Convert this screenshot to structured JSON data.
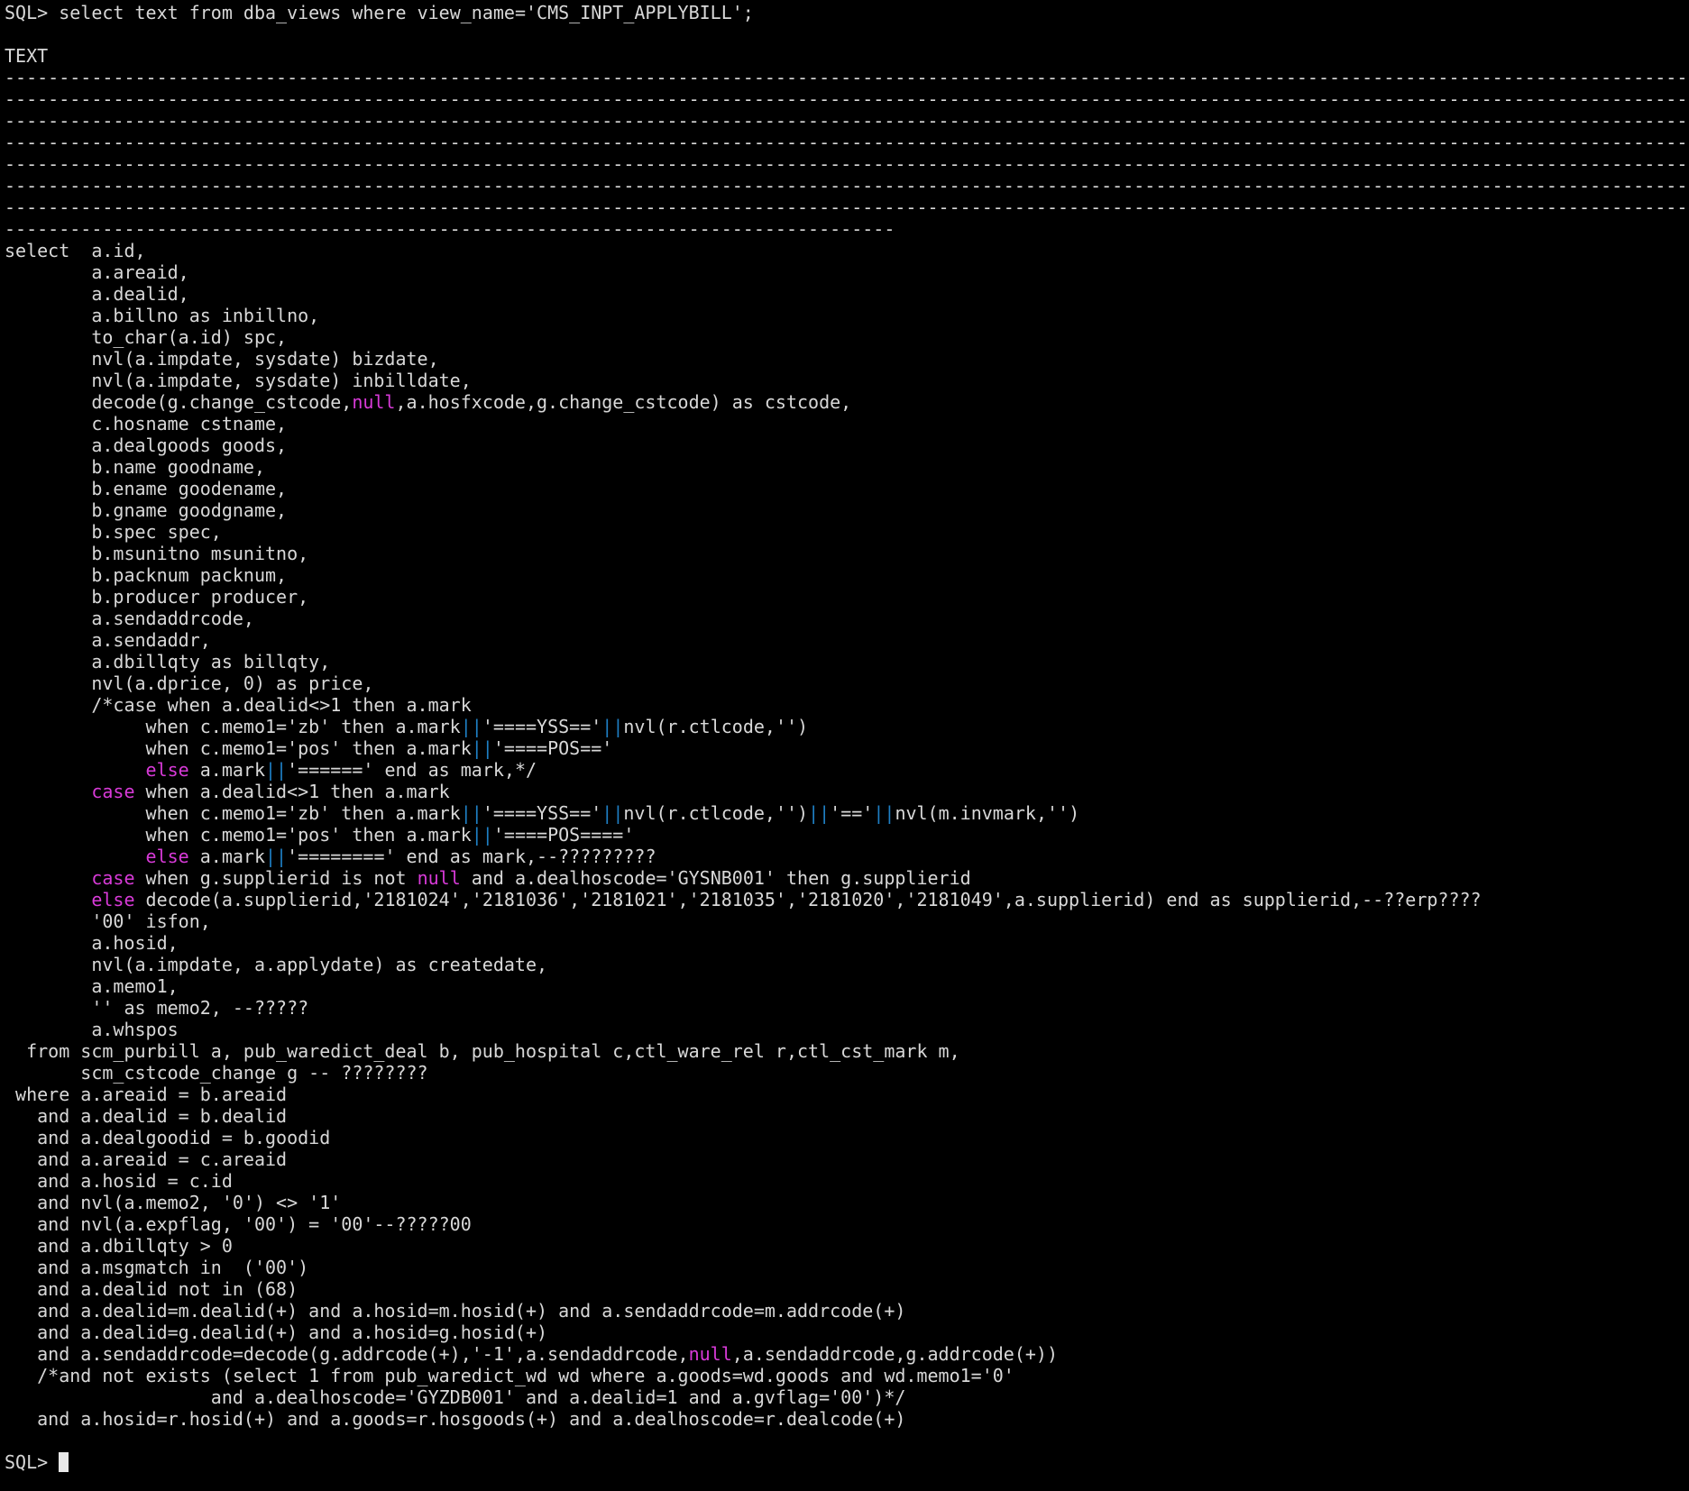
{
  "terminal": {
    "prompt": "SQL> ",
    "command": "select text from dba_views where view_name='CMS_INPT_APPLYBILL';",
    "column_header": "TEXT",
    "separator_full": "----------------------------------------------------------------------------------------------------------------------------------------------------------------",
    "separator_tail": "----------------------------------------------------------------------------------",
    "final_prompt": "SQL> ",
    "colors": {
      "background": "#000000",
      "text": "#d8d8d8",
      "keyword": "#d83ad8",
      "pipe": "#1e7fc4"
    },
    "sql_lines": [
      [
        {
          "t": "select  a.id,"
        }
      ],
      [
        {
          "t": "        a.areaid,"
        }
      ],
      [
        {
          "t": "        a.dealid,"
        }
      ],
      [
        {
          "t": "        a.billno as inbillno,"
        }
      ],
      [
        {
          "t": "        to_char(a.id) spc,"
        }
      ],
      [
        {
          "t": "        nvl(a.impdate, sysdate) bizdate,"
        }
      ],
      [
        {
          "t": "        nvl(a.impdate, sysdate) inbilldate,"
        }
      ],
      [
        {
          "t": "        decode(g.change_cstcode,"
        },
        {
          "t": "null",
          "c": "kw"
        },
        {
          "t": ",a.hosfxcode,g.change_cstcode) as cstcode,"
        }
      ],
      [
        {
          "t": "        c.hosname cstname,"
        }
      ],
      [
        {
          "t": "        a.dealgoods goods,"
        }
      ],
      [
        {
          "t": "        b.name goodname,"
        }
      ],
      [
        {
          "t": "        b.ename goodename,"
        }
      ],
      [
        {
          "t": "        b.gname goodgname,"
        }
      ],
      [
        {
          "t": "        b.spec spec,"
        }
      ],
      [
        {
          "t": "        b.msunitno msunitno,"
        }
      ],
      [
        {
          "t": "        b.packnum packnum,"
        }
      ],
      [
        {
          "t": "        b.producer producer,"
        }
      ],
      [
        {
          "t": "        a.sendaddrcode,"
        }
      ],
      [
        {
          "t": "        a.sendaddr,"
        }
      ],
      [
        {
          "t": "        a.dbillqty as billqty,"
        }
      ],
      [
        {
          "t": "        nvl(a.dprice, 0) as price,"
        }
      ],
      [
        {
          "t": "        /*case when a.dealid<>1 then a.mark"
        }
      ],
      [
        {
          "t": "             when c.memo1='zb' then a.mark"
        },
        {
          "t": "||",
          "c": "pipe"
        },
        {
          "t": "'====YSS=='"
        },
        {
          "t": "||",
          "c": "pipe"
        },
        {
          "t": "nvl(r.ctlcode,'')"
        }
      ],
      [
        {
          "t": "             when c.memo1='pos' then a.mark"
        },
        {
          "t": "||",
          "c": "pipe"
        },
        {
          "t": "'====POS=='"
        }
      ],
      [
        {
          "t": "             "
        },
        {
          "t": "else",
          "c": "kw"
        },
        {
          "t": " a.mark"
        },
        {
          "t": "||",
          "c": "pipe"
        },
        {
          "t": "'======' end as mark,*/"
        }
      ],
      [
        {
          "t": "        "
        },
        {
          "t": "case",
          "c": "kw"
        },
        {
          "t": " when a.dealid<>1 then a.mark"
        }
      ],
      [
        {
          "t": "             when c.memo1='zb' then a.mark"
        },
        {
          "t": "||",
          "c": "pipe"
        },
        {
          "t": "'====YSS=='"
        },
        {
          "t": "||",
          "c": "pipe"
        },
        {
          "t": "nvl(r.ctlcode,'')"
        },
        {
          "t": "||",
          "c": "pipe"
        },
        {
          "t": "'=='"
        },
        {
          "t": "||",
          "c": "pipe"
        },
        {
          "t": "nvl(m.invmark,'')"
        }
      ],
      [
        {
          "t": "             when c.memo1='pos' then a.mark"
        },
        {
          "t": "||",
          "c": "pipe"
        },
        {
          "t": "'====POS===='"
        }
      ],
      [
        {
          "t": "             "
        },
        {
          "t": "else",
          "c": "kw"
        },
        {
          "t": " a.mark"
        },
        {
          "t": "||",
          "c": "pipe"
        },
        {
          "t": "'========' end as mark,--?????????"
        }
      ],
      [
        {
          "t": "        "
        },
        {
          "t": "case",
          "c": "kw"
        },
        {
          "t": " when g.supplierid is not "
        },
        {
          "t": "null",
          "c": "kw"
        },
        {
          "t": " and a.dealhoscode='GYSNB001' then g.supplierid"
        }
      ],
      [
        {
          "t": "        "
        },
        {
          "t": "else",
          "c": "kw"
        },
        {
          "t": " decode(a.supplierid,'2181024','2181036','2181021','2181035','2181020','2181049',a.supplierid) end as supplierid,--??erp????"
        }
      ],
      [
        {
          "t": "        '00' isfon,"
        }
      ],
      [
        {
          "t": "        a.hosid,"
        }
      ],
      [
        {
          "t": "        nvl(a.impdate, a.applydate) as createdate,"
        }
      ],
      [
        {
          "t": "        a.memo1,"
        }
      ],
      [
        {
          "t": "        '' as memo2, --?????"
        }
      ],
      [
        {
          "t": "        a.whspos"
        }
      ],
      [
        {
          "t": "  from scm_purbill a, pub_waredict_deal b, pub_hospital c,ctl_ware_rel r,ctl_cst_mark m,"
        }
      ],
      [
        {
          "t": "       scm_cstcode_change g -- ????????"
        }
      ],
      [
        {
          "t": " where a.areaid = b.areaid"
        }
      ],
      [
        {
          "t": "   and a.dealid = b.dealid"
        }
      ],
      [
        {
          "t": "   and a.dealgoodid = b.goodid"
        }
      ],
      [
        {
          "t": "   and a.areaid = c.areaid"
        }
      ],
      [
        {
          "t": "   and a.hosid = c.id"
        }
      ],
      [
        {
          "t": "   and nvl(a.memo2, '0') <> '1'"
        }
      ],
      [
        {
          "t": "   and nvl(a.expflag, '00') = '00'--?????00"
        }
      ],
      [
        {
          "t": "   and a.dbillqty > 0"
        }
      ],
      [
        {
          "t": "   and a.msgmatch in  ('00')"
        }
      ],
      [
        {
          "t": "   and a.dealid not in (68)"
        }
      ],
      [
        {
          "t": "   and a.dealid=m.dealid(+) and a.hosid=m.hosid(+) and a.sendaddrcode=m.addrcode(+)"
        }
      ],
      [
        {
          "t": "   and a.dealid=g.dealid(+) and a.hosid=g.hosid(+)"
        }
      ],
      [
        {
          "t": "   and a.sendaddrcode=decode(g.addrcode(+),'-1',a.sendaddrcode,"
        },
        {
          "t": "null",
          "c": "kw"
        },
        {
          "t": ",a.sendaddrcode,g.addrcode(+))"
        }
      ],
      [
        {
          "t": "   /*and not exists (select 1 from pub_waredict_wd wd where a.goods=wd.goods and wd.memo1='0'"
        }
      ],
      [
        {
          "t": "                   and a.dealhoscode='GYZDB001' and a.dealid=1 and a.gvflag='00')*/"
        }
      ],
      [
        {
          "t": "   and a.hosid=r.hosid(+) and a.goods=r.hosgoods(+) and a.dealhoscode=r.dealcode(+)"
        }
      ]
    ]
  }
}
